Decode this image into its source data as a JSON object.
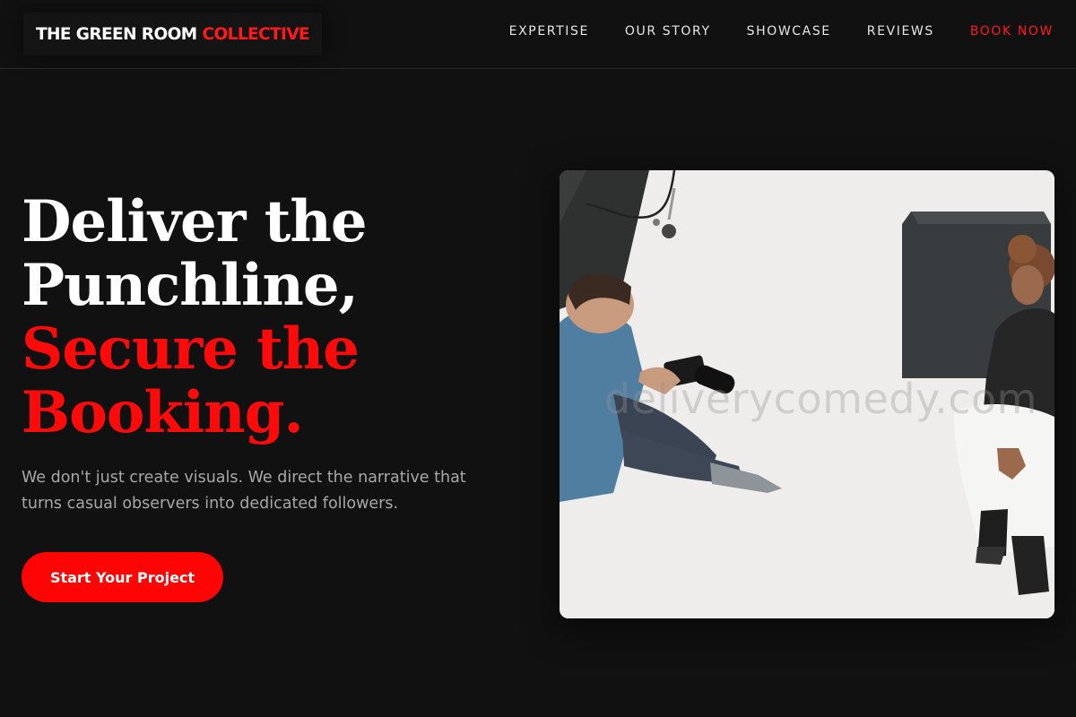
{
  "header": {
    "logo_primary": "THE GREEN ROOM",
    "logo_accent": "COLLECTIVE",
    "nav": [
      {
        "label": "EXPERTISE"
      },
      {
        "label": "OUR STORY"
      },
      {
        "label": "SHOWCASE"
      },
      {
        "label": "REVIEWS"
      },
      {
        "label": "BOOK NOW"
      }
    ]
  },
  "hero": {
    "headline_white_1": "Deliver the",
    "headline_white_2": "Punchline,",
    "headline_red_1": "Secure the",
    "headline_red_2": "Booking.",
    "subtext": "We don't just create visuals. We direct the narrative that turns casual observers into dedicated followers.",
    "cta_label": "Start Your Project",
    "image_watermark": "deliverycomedy.com"
  },
  "colors": {
    "background": "#111112",
    "accent": "#ff0a0a",
    "text": "#ffffff",
    "muted_text": "#a8a8a8"
  }
}
